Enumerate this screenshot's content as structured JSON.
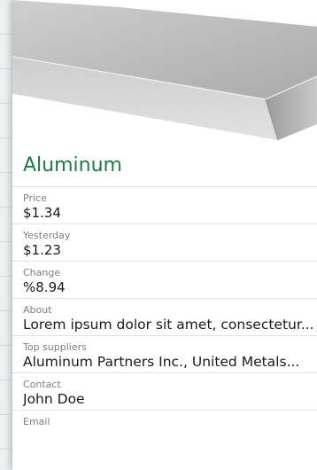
{
  "detail": {
    "title": "Aluminum",
    "fields": [
      {
        "label": "Price",
        "value": "$1.34"
      },
      {
        "label": "Yesterday",
        "value": "$1.23"
      },
      {
        "label": "Change",
        "value": "%8.94"
      },
      {
        "label": "About",
        "value": "Lorem ipsum dolor sit amet, consectetur..."
      },
      {
        "label": "Top suppliers",
        "value": "Aluminum Partners Inc., United Metals..."
      },
      {
        "label": "Contact",
        "value": "John Doe"
      },
      {
        "label": "Email",
        "value": ""
      }
    ]
  },
  "colors": {
    "title": "#1e7a48",
    "label": "#7a7f84",
    "value": "#1a1a1a"
  },
  "icons": {
    "hero": "aluminum-bar-image"
  }
}
